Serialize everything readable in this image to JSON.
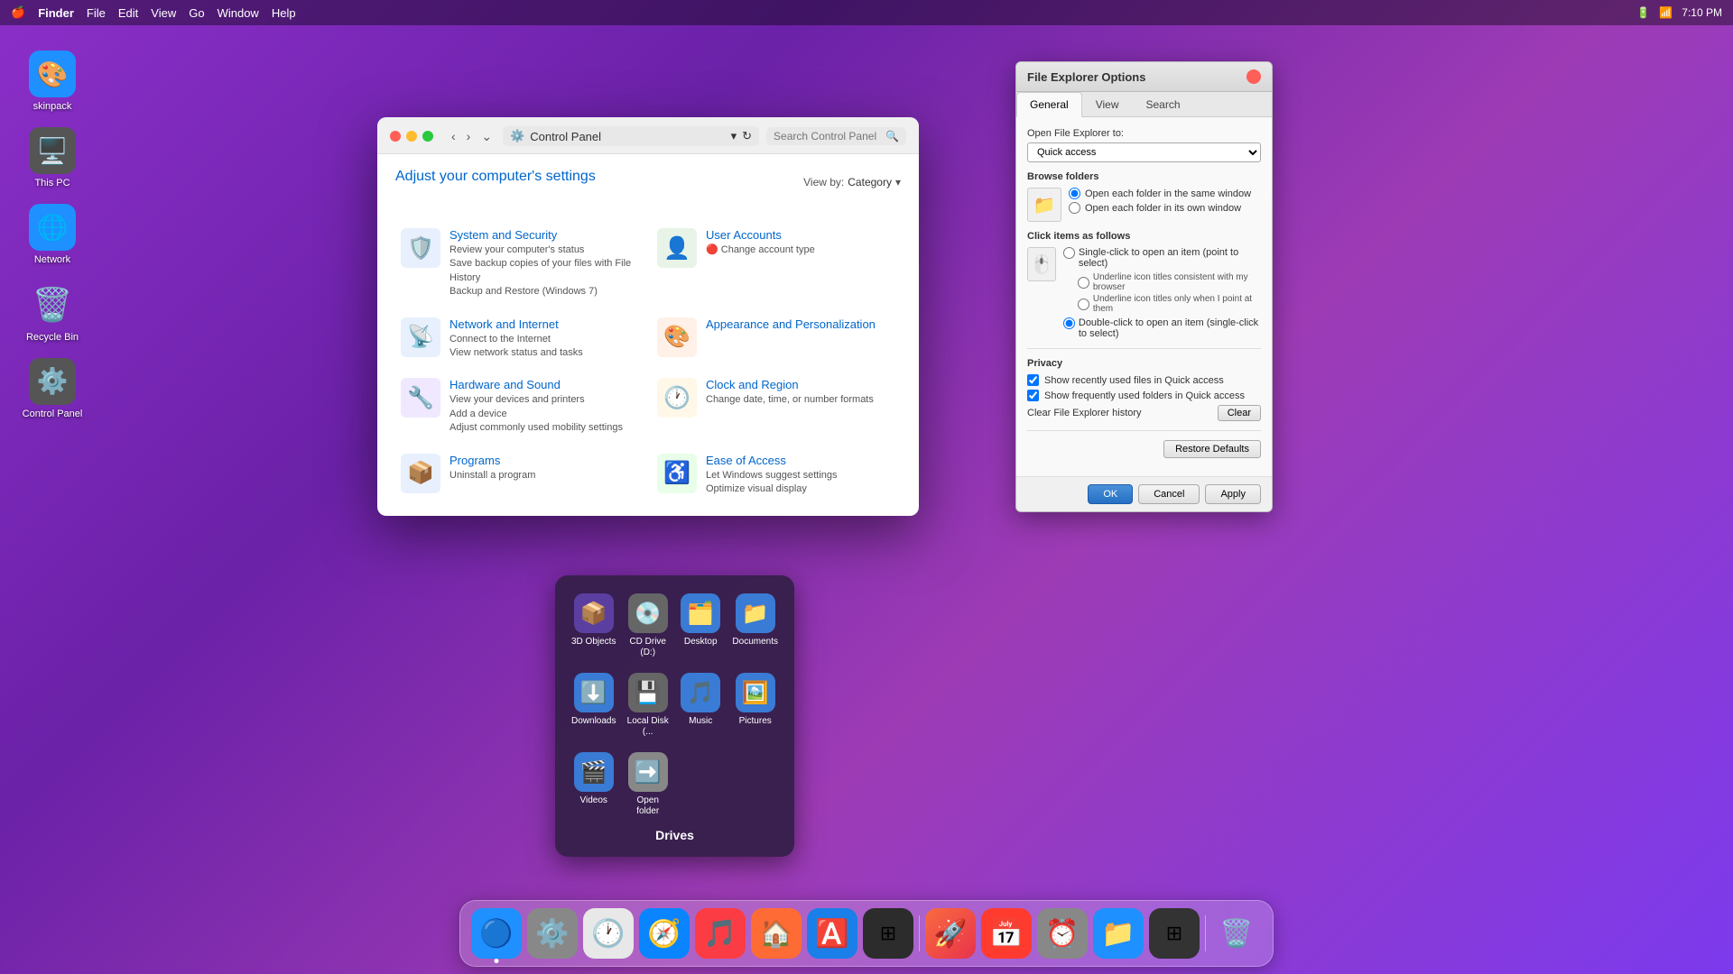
{
  "topbar": {
    "apple": "🍎",
    "time": "7:10 PM",
    "items": [
      "Finder",
      "File",
      "Edit",
      "View",
      "Go",
      "Window",
      "Help"
    ]
  },
  "desktop_icons": [
    {
      "id": "skinpack",
      "label": "skinpack",
      "emoji": "🎨",
      "bg": "#2080e0"
    },
    {
      "id": "this-pc",
      "label": "This PC",
      "emoji": "🖥️",
      "bg": "#555"
    },
    {
      "id": "network",
      "label": "Network",
      "emoji": "🌐",
      "bg": "#2080e0"
    },
    {
      "id": "recycle-bin",
      "label": "Recycle Bin",
      "emoji": "🗑️",
      "bg": "transparent"
    },
    {
      "id": "control-panel",
      "label": "Control Panel",
      "emoji": "⚙️",
      "bg": "#555"
    }
  ],
  "control_panel": {
    "title": "Control Panel",
    "subtitle": "Adjust your computer's settings",
    "view_by_label": "View by:",
    "view_by_value": "Category",
    "search_placeholder": "Search Control Panel",
    "categories": [
      {
        "id": "system-security",
        "name": "System and Security",
        "desc": "Review your computer's status\nSave backup copies of your files with File History\nBackup and Restore (Windows 7)",
        "emoji": "🛡️",
        "bg": "#e8f0fe"
      },
      {
        "id": "user-accounts",
        "name": "User Accounts",
        "desc": "🔴 Change account type",
        "emoji": "👤",
        "bg": "#e8f4e8"
      },
      {
        "id": "network-internet",
        "name": "Network and Internet",
        "desc": "Connect to the Internet\nView network status and tasks",
        "emoji": "📡",
        "bg": "#e8f0fe"
      },
      {
        "id": "appearance",
        "name": "Appearance and Personalization",
        "desc": "",
        "emoji": "🎨",
        "bg": "#fff0e8"
      },
      {
        "id": "hardware-sound",
        "name": "Hardware and Sound",
        "desc": "View your devices and printers\nAdd a device\nAdjust commonly used mobility settings",
        "emoji": "🔧",
        "bg": "#f0e8fe"
      },
      {
        "id": "clock-region",
        "name": "Clock and Region",
        "desc": "Change date, time, or number formats",
        "emoji": "🕐",
        "bg": "#fff8e8"
      },
      {
        "id": "programs",
        "name": "Programs",
        "desc": "Uninstall a program",
        "emoji": "📦",
        "bg": "#e8f0fe"
      },
      {
        "id": "ease-access",
        "name": "Ease of Access",
        "desc": "Let Windows suggest settings\nOptimize visual display",
        "emoji": "♿",
        "bg": "#e8fee8"
      }
    ]
  },
  "file_explorer_dialog": {
    "title": "File Explorer Options",
    "tabs": [
      "General",
      "View",
      "Search"
    ],
    "active_tab": "General",
    "open_to_label": "Open File Explorer to:",
    "open_to_value": "Quick access",
    "browse_folders_title": "Browse folders",
    "browse_option1": "Open each folder in the same window",
    "browse_option2": "Open each folder in its own window",
    "click_title": "Click items as follows",
    "click_option1": "Single-click to open an item (point to select)",
    "sub_option1": "Underline icon titles consistent with my browser",
    "sub_option2": "Underline icon titles only when I point at them",
    "click_option2": "Double-click to open an item (single-click to select)",
    "privacy_title": "Privacy",
    "privacy_check1": "Show recently used files in Quick access",
    "privacy_check2": "Show frequently used folders in Quick access",
    "clear_history_label": "Clear File Explorer history",
    "clear_btn": "Clear",
    "restore_defaults_btn": "Restore Defaults",
    "ok_btn": "OK",
    "cancel_btn": "Cancel",
    "apply_btn": "Apply"
  },
  "drives_popup": {
    "title": "Drives",
    "items": [
      {
        "id": "3d-objects",
        "label": "3D Objects",
        "emoji": "📦",
        "bg": "#5b3fa0"
      },
      {
        "id": "cd-drive",
        "label": "CD Drive (D:)",
        "emoji": "💿",
        "bg": "#666"
      },
      {
        "id": "desktop",
        "label": "Desktop",
        "emoji": "🗂️",
        "bg": "#3a7bd5"
      },
      {
        "id": "documents",
        "label": "Documents",
        "emoji": "📁",
        "bg": "#3a7bd5"
      },
      {
        "id": "downloads",
        "label": "Downloads",
        "emoji": "⬇️",
        "bg": "#3a7bd5"
      },
      {
        "id": "local-disk",
        "label": "Local Disk (...",
        "emoji": "💾",
        "bg": "#666"
      },
      {
        "id": "music",
        "label": "Music",
        "emoji": "🎵",
        "bg": "#3a7bd5"
      },
      {
        "id": "pictures",
        "label": "Pictures",
        "emoji": "🖼️",
        "bg": "#3a7bd5"
      },
      {
        "id": "videos",
        "label": "Videos",
        "emoji": "🎬",
        "bg": "#3a7bd5"
      },
      {
        "id": "open-folder",
        "label": "Open folder",
        "emoji": "➡️",
        "bg": "#888"
      }
    ]
  },
  "dock": {
    "items": [
      {
        "id": "finder",
        "emoji": "🔵",
        "bg": "#1e90ff",
        "active": true
      },
      {
        "id": "system-prefs",
        "emoji": "⚙️",
        "bg": "#888"
      },
      {
        "id": "clock",
        "emoji": "🕐",
        "bg": "#f0f0f0"
      },
      {
        "id": "safari",
        "emoji": "🧭",
        "bg": "#0a84ff"
      },
      {
        "id": "music",
        "emoji": "🎵",
        "bg": "#fc3c44"
      },
      {
        "id": "home",
        "emoji": "🏠",
        "bg": "#ff6b35"
      },
      {
        "id": "app-store",
        "emoji": "🅰️",
        "bg": "#1a7fe8"
      },
      {
        "id": "boot-camp",
        "emoji": "⊞",
        "bg": "#2c2c2c"
      },
      {
        "id": "launchpad",
        "emoji": "🚀",
        "bg": "#ee4444"
      },
      {
        "id": "calendar",
        "emoji": "📅",
        "bg": "#ff3b30"
      },
      {
        "id": "time-machine",
        "emoji": "⏰",
        "bg": "#888"
      },
      {
        "id": "files",
        "emoji": "📁",
        "bg": "#1e90ff"
      },
      {
        "id": "mosaic",
        "emoji": "⊞",
        "bg": "#333"
      },
      {
        "id": "trash",
        "emoji": "🗑️",
        "bg": "transparent"
      }
    ]
  }
}
